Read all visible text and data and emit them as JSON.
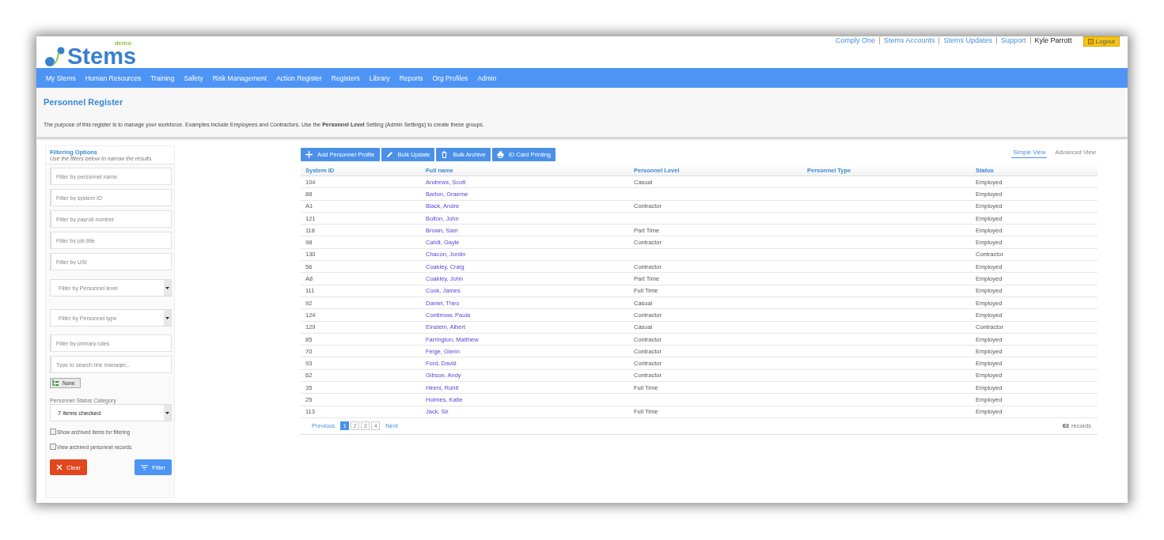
{
  "header": {
    "logo_tag": "demo",
    "logo_text": "Stems",
    "links": [
      "Comply One",
      "Stems Accounts",
      "Stems Updates",
      "Support"
    ],
    "user": "Kyle Parrott",
    "logout": "Logout"
  },
  "nav": {
    "items": [
      "My Stems",
      "Human Resources",
      "Training",
      "Safety",
      "Risk Management",
      "Action Register",
      "Registers",
      "Library",
      "Reports",
      "Org Profiles",
      "Admin"
    ]
  },
  "page": {
    "title": "Personnel Register",
    "description": "The purpose of this register is to manage your workforce. Examples include Employees and Contractors. Use the **Personnel Level** Setting (Admin Settings) to create these groups."
  },
  "filters": {
    "title": "Filtering Options",
    "subtitle": "Use the filters below to narrow the results",
    "fields": [
      {
        "kind": "text",
        "placeholder": "Filter by personnel name"
      },
      {
        "kind": "text",
        "placeholder": "Filter by system ID"
      },
      {
        "kind": "text",
        "placeholder": "Filter by payroll number"
      },
      {
        "kind": "text",
        "placeholder": "Filter by job title"
      },
      {
        "kind": "text",
        "placeholder": "Filter by USI"
      },
      {
        "kind": "select",
        "placeholder": "Filter by Personnel level"
      },
      {
        "kind": "select",
        "placeholder": "Filter by Personnel type"
      },
      {
        "kind": "text",
        "placeholder": "Filter by primary roles"
      },
      {
        "kind": "text",
        "placeholder": "Type to search line manager..."
      }
    ],
    "tree_chip": "None",
    "status_label": "Personnel Status Category",
    "status_value": "7 items checked",
    "checkboxes": [
      {
        "label": "Show archived items for filtering",
        "checked": false
      },
      {
        "label": "View archived personnel records",
        "checked": false
      }
    ],
    "clear": "Clear",
    "filter": "Filter"
  },
  "toolbar": {
    "buttons": [
      {
        "kind": "add",
        "label": "Add Personnel Profile"
      },
      {
        "kind": "edit",
        "label": "Bulk Update"
      },
      {
        "kind": "archive",
        "label": "Bulk Archive"
      },
      {
        "kind": "print",
        "label": "ID Card Printing"
      }
    ],
    "views": [
      {
        "label": "Simple View",
        "selected": true
      },
      {
        "label": "Advanced View",
        "selected": false
      }
    ]
  },
  "table": {
    "columns": [
      "System ID",
      "Full name",
      "Personnel Level",
      "Personnel Type",
      "Status"
    ],
    "rows": [
      [
        "104",
        "Andrews, Scott",
        "Casual",
        "",
        "Employed"
      ],
      [
        "88",
        "Barton, Graeme",
        "",
        "",
        "Employed"
      ],
      [
        "A1",
        "Black, Andre",
        "Contractor",
        "",
        "Employed"
      ],
      [
        "121",
        "Bolton, John",
        "",
        "",
        "Employed"
      ],
      [
        "118",
        "Brown, Sam",
        "Part Time",
        "",
        "Employed"
      ],
      [
        "98",
        "Cahill, Gayle",
        "Contractor",
        "",
        "Employed"
      ],
      [
        "130",
        "Chacon, Jordin",
        "",
        "",
        "Contractor"
      ],
      [
        "56",
        "Coakley, Craig",
        "Contractor",
        "",
        "Employed"
      ],
      [
        "A8",
        "Coakley, John",
        "Part Time",
        "",
        "Employed"
      ],
      [
        "111",
        "Cook, James",
        "Full Time",
        "",
        "Employed"
      ],
      [
        "92",
        "Daniel, Theo",
        "Casual",
        "",
        "Employed"
      ],
      [
        "124",
        "Contimow, Paula",
        "Contractor",
        "",
        "Employed"
      ],
      [
        "129",
        "Einstein, Albert",
        "Casual",
        "",
        "Contractor"
      ],
      [
        "85",
        "Farrington, Matthew",
        "Contractor",
        "",
        "Employed"
      ],
      [
        "70",
        "Feige, Glenn",
        "Contractor",
        "",
        "Employed"
      ],
      [
        "93",
        "Ford, David",
        "Contractor",
        "",
        "Employed"
      ],
      [
        "62",
        "Gibson, Andy",
        "Contractor",
        "",
        "Employed"
      ],
      [
        "35",
        "Hireni, Rohit",
        "Full Time",
        "",
        "Employed"
      ],
      [
        "25",
        "Holmes, Katie",
        "",
        "",
        "Employed"
      ],
      [
        "113",
        "Jack, Sir",
        "Full Time",
        "",
        "Employed"
      ]
    ]
  },
  "pagination": {
    "previous": "Previous",
    "pages": [
      {
        "label": "1",
        "selected": true
      },
      {
        "label": "2",
        "selected": false
      },
      {
        "label": "3",
        "selected": false
      },
      {
        "label": "4",
        "selected": false
      }
    ],
    "next": "Next",
    "count": "63",
    "count_label": "records"
  }
}
